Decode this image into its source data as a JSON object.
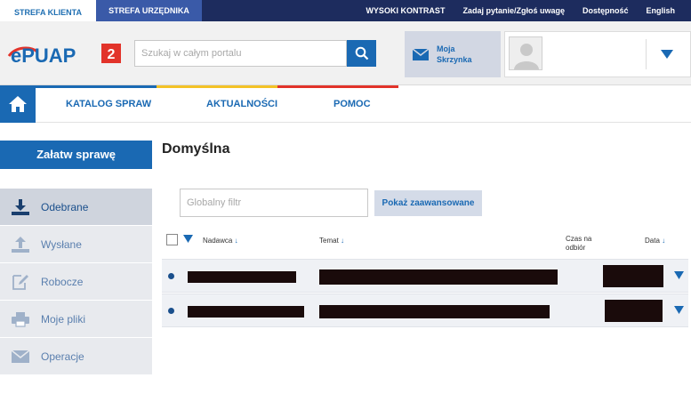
{
  "top_bar": {
    "zone_tabs": [
      "STREFA KLIENTA",
      "STREFA URZĘDNIKA"
    ],
    "links": [
      "WYSOKI KONTRAST",
      "Zadaj pytanie/Zgłoś uwagę",
      "Dostępność",
      "English"
    ]
  },
  "header": {
    "logo_text": "ePUAP",
    "logo_badge": "2",
    "search_placeholder": "Szukaj w całym portalu",
    "inbox_label": "Moja Skrzynka"
  },
  "nav": {
    "items": [
      "KATALOG SPRAW",
      "AKTUALNOŚCI",
      "POMOC"
    ]
  },
  "sidebar": {
    "cta_label": "Załatw sprawę",
    "items": [
      {
        "label": "Odebrane",
        "icon": "download-icon",
        "active": true
      },
      {
        "label": "Wysłane",
        "icon": "upload-icon",
        "active": false
      },
      {
        "label": "Robocze",
        "icon": "edit-icon",
        "active": false
      },
      {
        "label": "Moje pliki",
        "icon": "printer-icon",
        "active": false
      },
      {
        "label": "Operacje",
        "icon": "envelope-icon",
        "active": false
      }
    ]
  },
  "main": {
    "title": "Domyślna",
    "filter_placeholder": "Globalny filtr",
    "advanced_button": "Pokaż zaawansowane",
    "columns": {
      "sender": "Nadawca",
      "subject": "Temat",
      "pickup_time": "Czas na odbiór",
      "date": "Data"
    }
  },
  "colors": {
    "navy": "#1d2c5e",
    "brand_blue": "#1a69b3",
    "logo_red": "#e2332a",
    "nav_stripe": [
      "#1a69b3",
      "#f3c227",
      "#e2332a"
    ]
  }
}
